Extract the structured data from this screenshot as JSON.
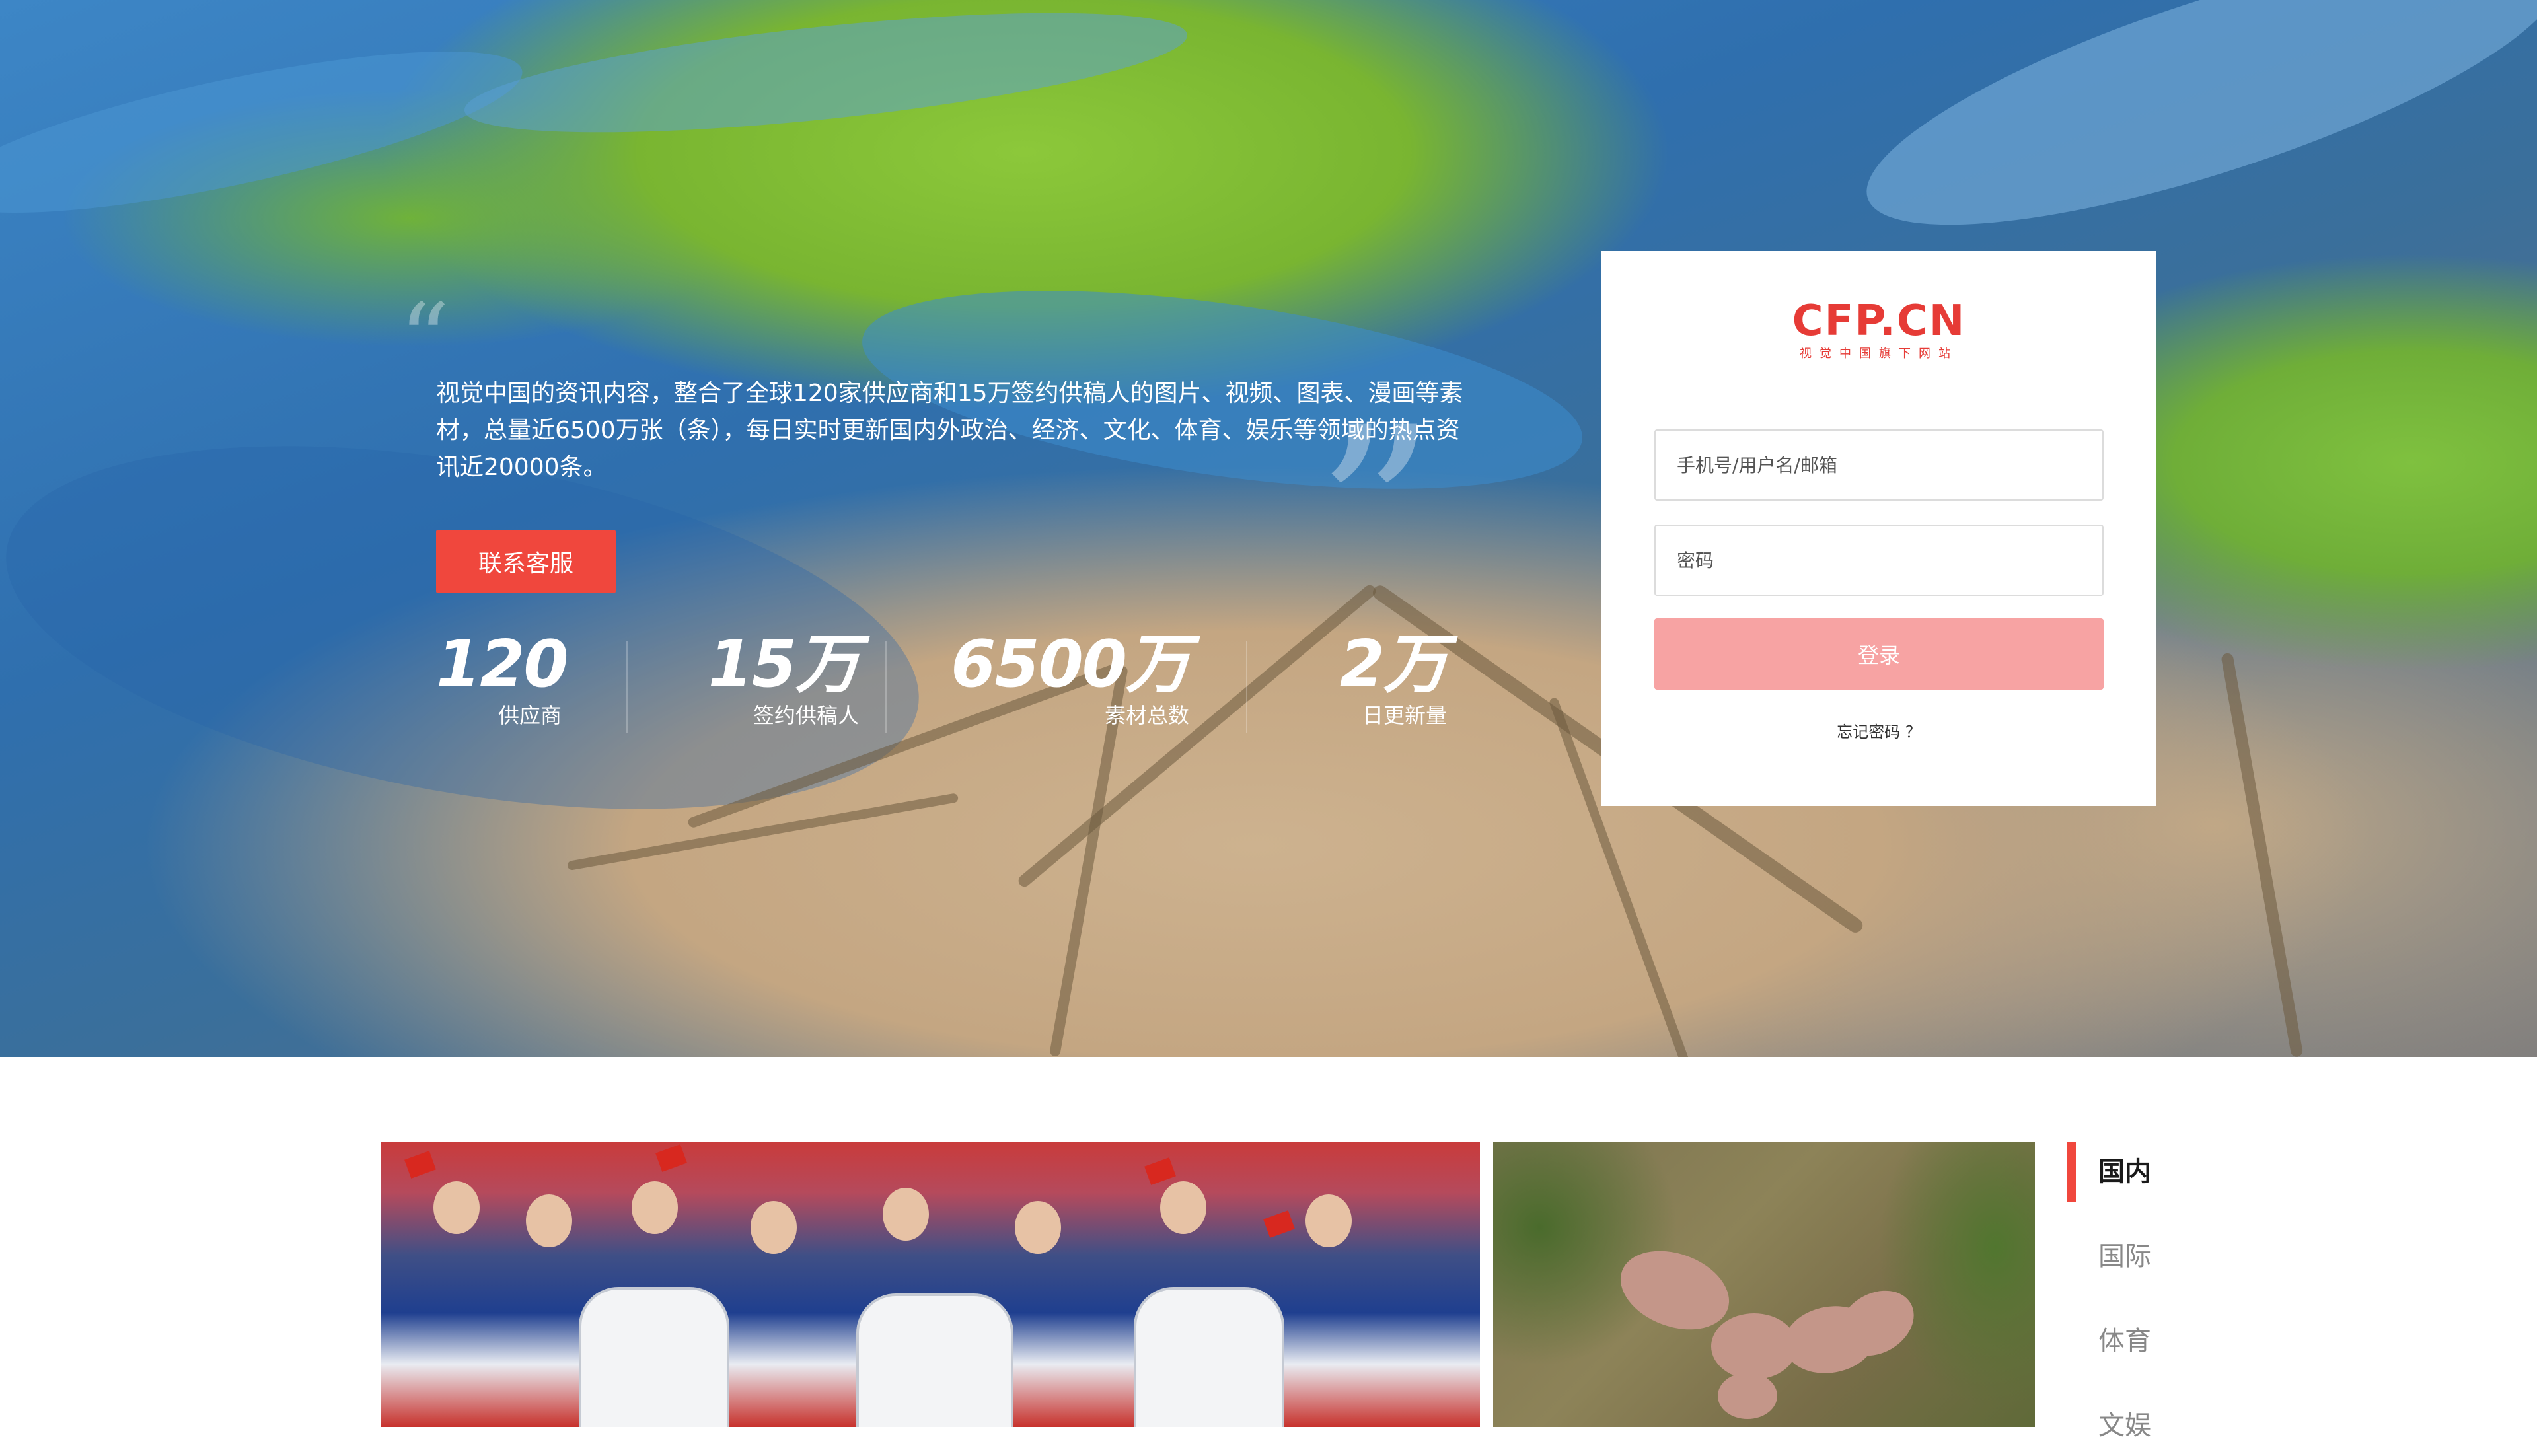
{
  "hero": {
    "description": "视觉中国的资讯内容，整合了全球120家供应商和15万签约供稿人的图片、视频、图表、漫画等素材，总量近6500万张（条），每日实时更新国内外政治、经济、文化、体育、娱乐等领域的热点资讯近20000条。",
    "contact_button": "联系客服",
    "open_quote": "“",
    "close_quote": "”",
    "stats": [
      {
        "value": "120",
        "label": "供应商"
      },
      {
        "value": "15万",
        "label": "签约供稿人"
      },
      {
        "value": "6500万",
        "label": "素材总数"
      },
      {
        "value": "2万",
        "label": "日更新量"
      }
    ]
  },
  "login": {
    "logo_text": "CFP.CN",
    "logo_subtitle": "视觉中国旗下网站",
    "username_placeholder": "手机号/用户名/邮箱",
    "password_placeholder": "密码",
    "submit_label": "登录",
    "forgot_label": "忘记密码 ？"
  },
  "categories": {
    "tabs": [
      {
        "label": "国内",
        "active": true
      },
      {
        "label": "国际",
        "active": false
      },
      {
        "label": "体育",
        "active": false
      },
      {
        "label": "文娱",
        "active": false
      }
    ]
  },
  "colors": {
    "accent": "#f0473d",
    "brand": "#e63b36",
    "login_button": "#f7a3a3"
  }
}
